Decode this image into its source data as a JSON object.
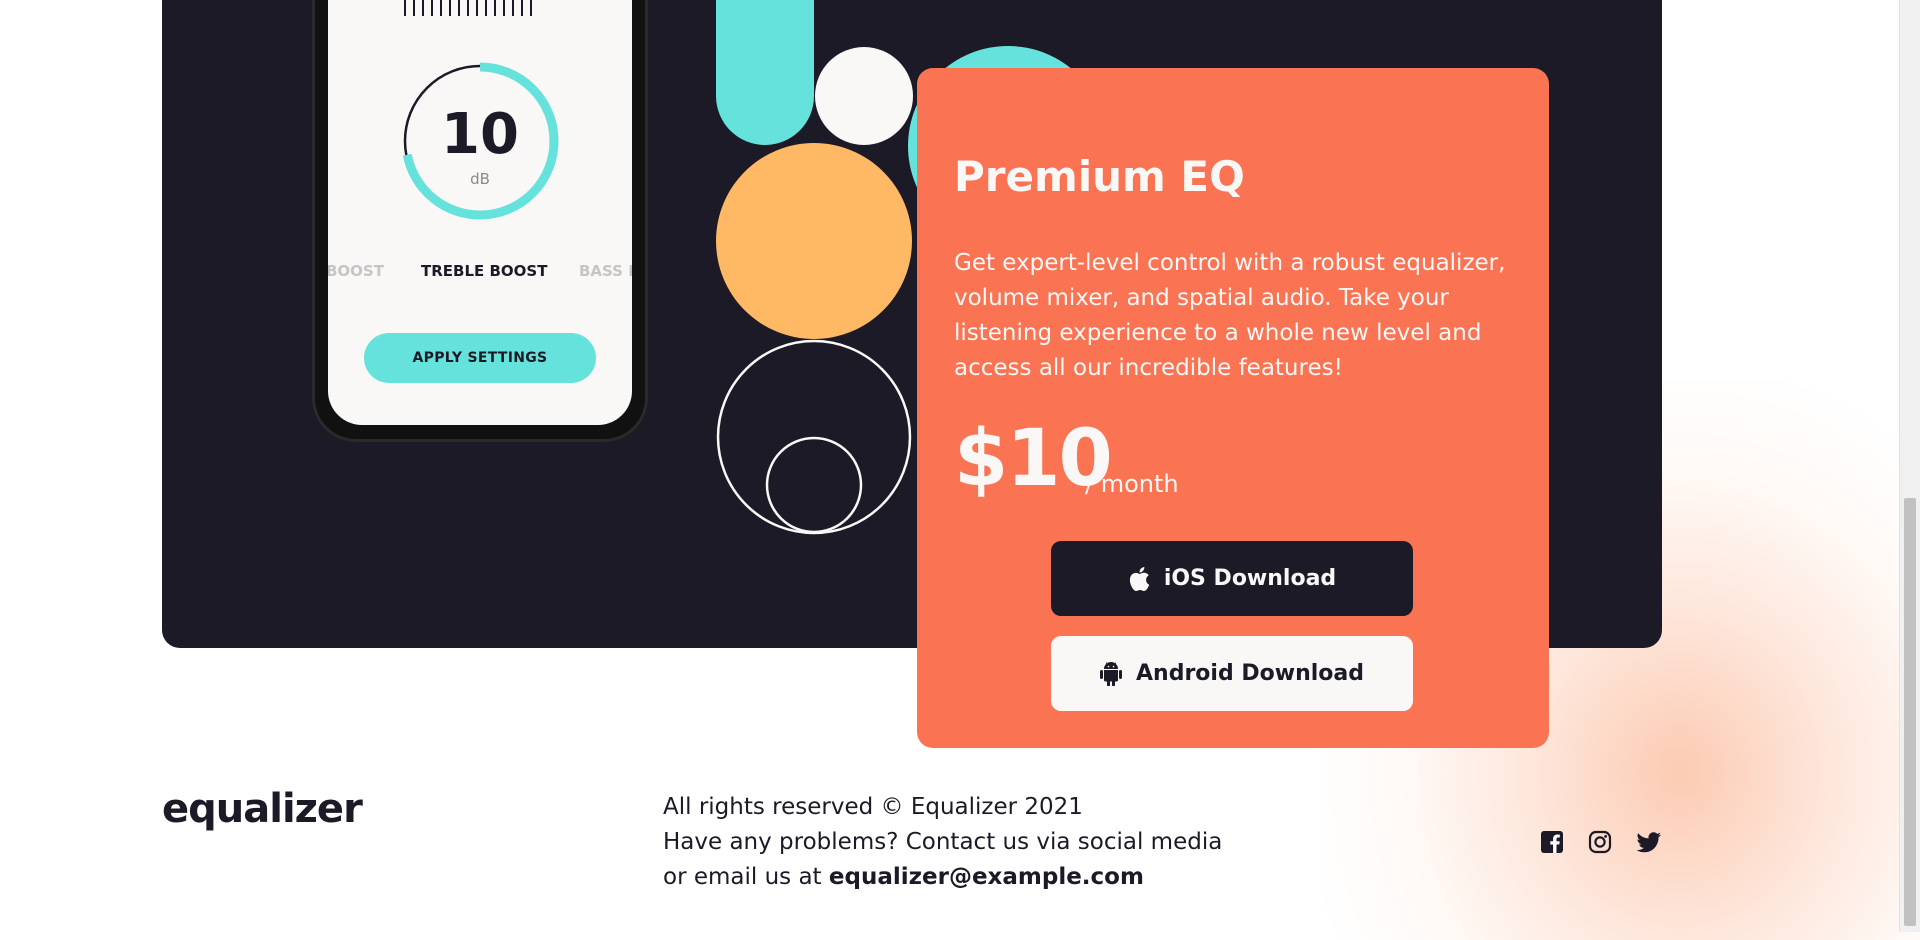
{
  "phone": {
    "dial_value": "10",
    "dial_unit": "dB",
    "modes": [
      "BOOST",
      "TREBLE BOOST",
      "BASS B"
    ],
    "apply_label": "APPLY SETTINGS",
    "dial_level": 0.72
  },
  "card": {
    "title": "Premium EQ",
    "description": "Get expert-level control with a robust equalizer, volume mixer, and spatial audio. Take your listening experience to a whole new level and access all our incredible features!",
    "price": "$10",
    "period": "/ month",
    "ios_label": "iOS Download",
    "android_label": "Android Download"
  },
  "footer": {
    "logo": "equalizer",
    "rights": "All rights reserved © Equalizer 2021",
    "contact": "Have any problems? Contact us via social media",
    "email_prefix": "or email us at",
    "email": "equalizer@example.com",
    "social_icons": [
      "facebook-icon",
      "instagram-icon",
      "twitter-icon"
    ]
  },
  "colors": {
    "dark": "#1b1a26",
    "coral": "#fa7453",
    "teal": "#66e2dc",
    "orange": "#ffb964",
    "cream": "#faf8f6"
  }
}
